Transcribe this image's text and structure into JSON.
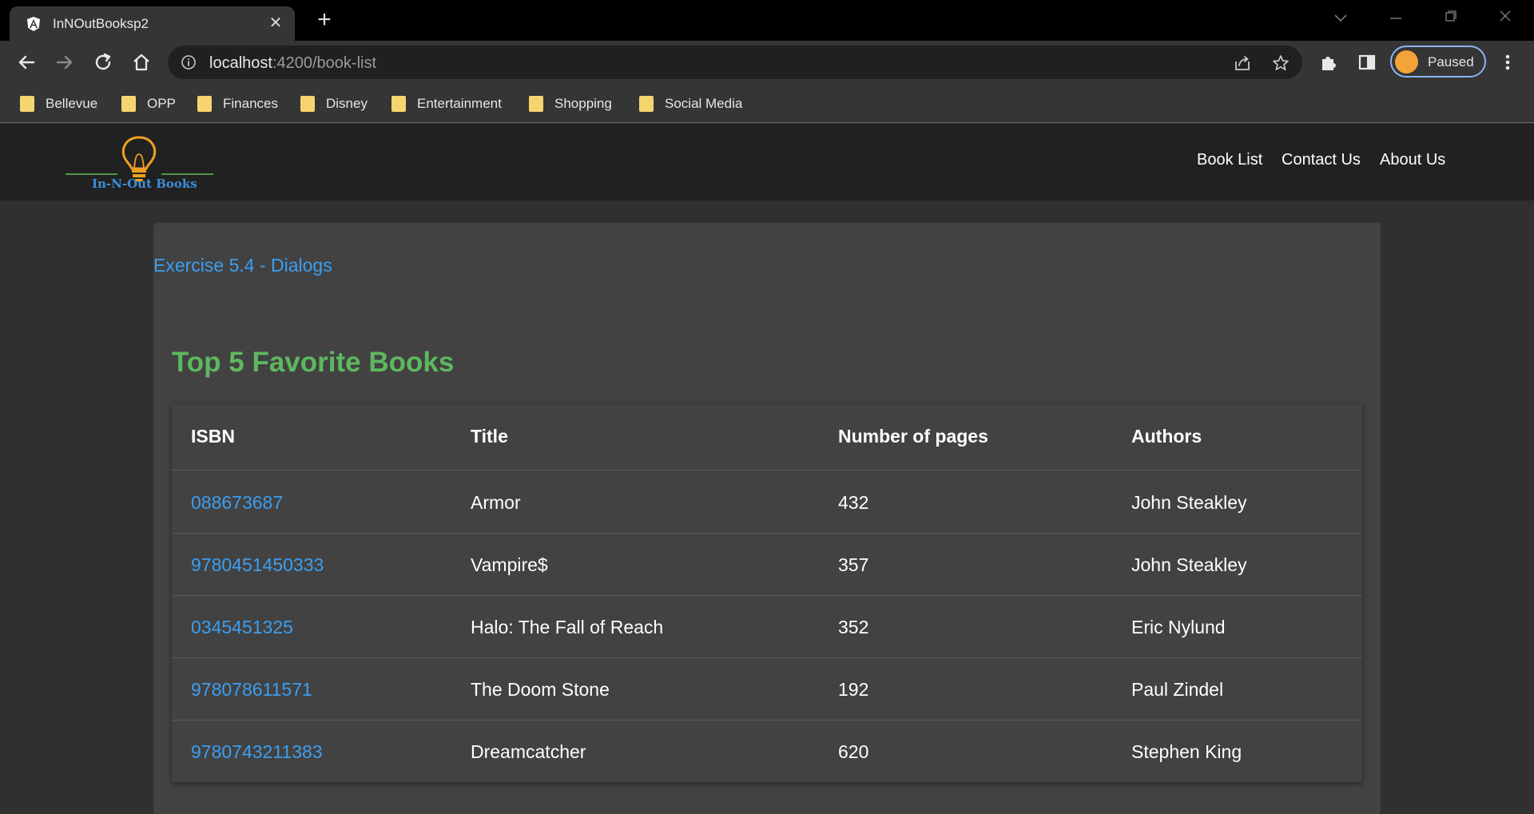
{
  "browser": {
    "tab": {
      "title": "InNOutBooksp2",
      "favicon": "angular-icon"
    },
    "url": {
      "host": "localhost",
      "rest": ":4200/book-list"
    },
    "profile": {
      "label": "Paused"
    },
    "bookmarks": [
      "Bellevue",
      "OPP",
      "Finances",
      "Disney",
      "Entertainment",
      "Shopping",
      "Social Media"
    ]
  },
  "header": {
    "logo_text": "In-N-Out Books",
    "nav": [
      "Book List",
      "Contact Us",
      "About Us"
    ]
  },
  "main": {
    "exercise_link": "Exercise 5.4 - Dialogs",
    "title": "Top 5 Favorite Books",
    "table": {
      "headers": [
        "ISBN",
        "Title",
        "Number of pages",
        "Authors"
      ],
      "rows": [
        {
          "isbn": "088673687",
          "title": "Armor",
          "pages": "432",
          "authors": "John Steakley"
        },
        {
          "isbn": "9780451450333",
          "title": "Vampire$",
          "pages": "357",
          "authors": "John Steakley"
        },
        {
          "isbn": "0345451325",
          "title": "Halo: The Fall of Reach",
          "pages": "352",
          "authors": "Eric Nylund"
        },
        {
          "isbn": "978078611571",
          "title": "The Doom Stone",
          "pages": "192",
          "authors": "Paul Zindel"
        },
        {
          "isbn": "9780743211383",
          "title": "Dreamcatcher",
          "pages": "620",
          "authors": "Stephen King"
        }
      ]
    }
  },
  "colors": {
    "link": "#3c9ef0",
    "title_green": "#5db85f",
    "card": "#424242",
    "header": "#212121"
  }
}
